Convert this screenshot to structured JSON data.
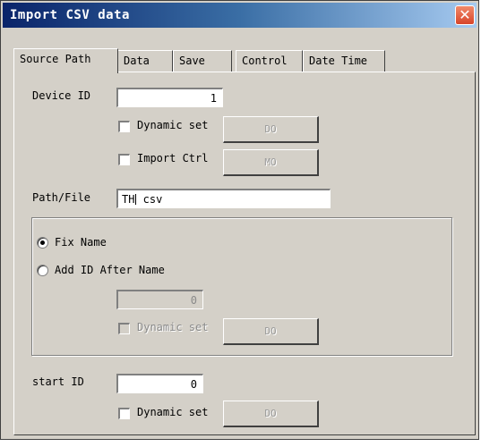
{
  "window": {
    "title": "Import CSV data",
    "close_glyph": "✕"
  },
  "tabs": [
    "Source Path",
    "Data",
    "Save",
    "Control",
    "Date Time"
  ],
  "device": {
    "label": "Device ID",
    "value": "1",
    "dynamic_set_label": "Dynamic set",
    "dynamic_set_checked": false,
    "do_button": "DO",
    "import_ctrl_label": "Import Ctrl",
    "import_ctrl_checked": false,
    "mo_button": "MO"
  },
  "path": {
    "label": "Path/File",
    "value_before_caret": "TH",
    "value_after_caret": " csv"
  },
  "naming": {
    "fix_name_label": "Fix Name",
    "fix_name_selected": true,
    "add_id_label": "Add ID After Name",
    "add_id_selected": false,
    "id_value": "0",
    "dynamic_set_label": "Dynamic set",
    "do_button": "DO"
  },
  "start": {
    "label": "start ID",
    "value": "0",
    "dynamic_set_label": "Dynamic set",
    "do_button": "DO"
  }
}
